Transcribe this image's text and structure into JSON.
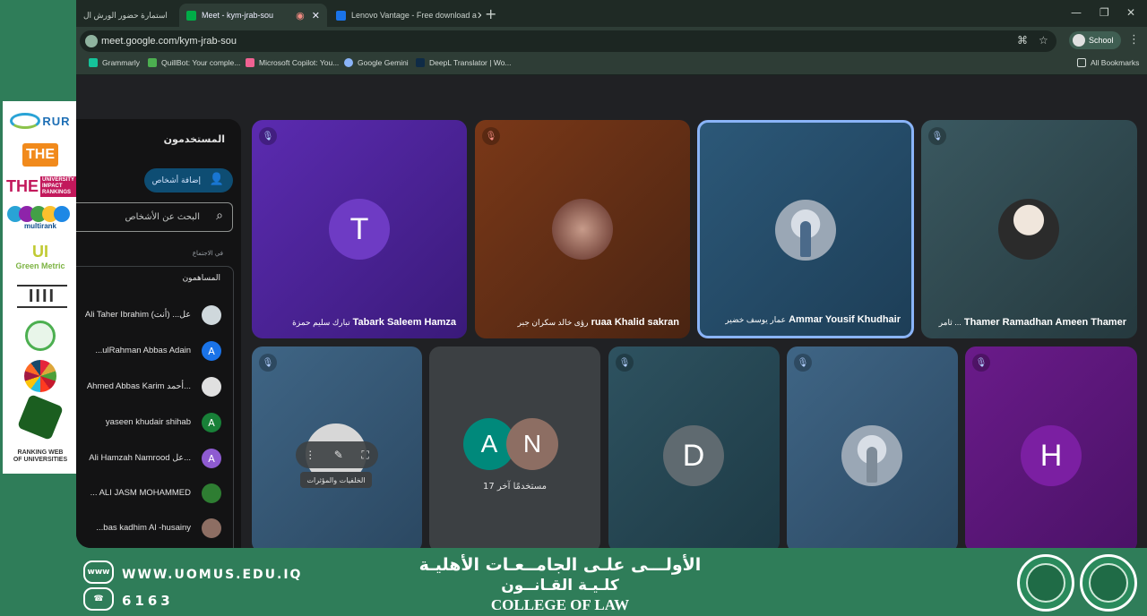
{
  "browser": {
    "tabs": [
      {
        "label": "استمارة حضور الورش ال",
        "active": false
      },
      {
        "label": "Meet - kym-jrab-sou",
        "active": true
      },
      {
        "label": "Lenovo Vantage - Free download a",
        "active": false
      }
    ],
    "url": "meet.google.com/kym-jrab-sou",
    "profile_label": "School",
    "bookmarks": [
      "Grammarly",
      "QuillBot: Your comple...",
      "Microsoft Copilot: You...",
      "Google Gemini",
      "DeepL Translator | Wo..."
    ],
    "all_bookmarks": "All Bookmarks"
  },
  "people_panel": {
    "title": "المستخدمون",
    "add_people": "إضافة أشخاص",
    "search_placeholder": "البحث عن الأشخاص",
    "in_meeting": "في الاجتماع",
    "contributors": "المساهمون",
    "participants": [
      {
        "name": "Ali Taher Ibrahim عل... (أنت)",
        "initial": "",
        "color": "#9e9e9e"
      },
      {
        "name": "...ulRahman Abbas Adain",
        "initial": "A",
        "color": "#1a73e8"
      },
      {
        "name": "Ahmed Abbas Karim أحمد...",
        "initial": "",
        "color": "#5f6368"
      },
      {
        "name": "yaseen khudair shihab",
        "initial": "A",
        "color": "#188038"
      },
      {
        "name": "Ali Hamzah Namrood عل...",
        "initial": "A",
        "color": "#8e5bd1"
      },
      {
        "name": "... ALI JASM MOHAMMED",
        "initial": "",
        "color": "#2e7d32"
      },
      {
        "name": "...bas kadhim Al -husainy",
        "initial": "",
        "color": "#6d4c41"
      }
    ]
  },
  "tiles": [
    {
      "name": "Tabark Saleem Hamza",
      "name_ar": "تبارك سليم حمزة",
      "initial": "T"
    },
    {
      "name": "ruaa Khalid sakran",
      "name_ar": "رؤى خالد سكران جبر"
    },
    {
      "name": "Ammar Yousif Khudhair",
      "name_ar": "عمار يوسف خضير"
    },
    {
      "name": "Thamer Ramadhan Ameen Thamer",
      "name_ar": "ثامر ..."
    },
    {
      "name": "",
      "name_ar": ""
    },
    {
      "name": "17 مستخدمًا آخر",
      "initials": [
        "A",
        "N"
      ]
    },
    {
      "initial": "D"
    },
    {
      "name": ""
    },
    {
      "initial": "H"
    }
  ],
  "hover_tooltip": "الخلفيات والمؤثرات",
  "banner": {
    "website": "WWW.UOMUS.EDU.IQ",
    "phone": "6163",
    "title_ar": "الأولـــى علـى الجامــعـات الأهليـة",
    "subtitle_ar": "كلـيـة القـانــون",
    "college_en": "COLLEGE OF LAW",
    "www_icon": "www-icon",
    "phone_icon": "phone-icon"
  },
  "logos": [
    "RUR",
    "THE",
    "THE UNIVERSITY IMPACT RANKINGS",
    "multirank",
    "UI Green Metric",
    "SDG",
    "اتحاد الجامعات العربية",
    "RANKING WEB OF UNIVERSITIES"
  ]
}
